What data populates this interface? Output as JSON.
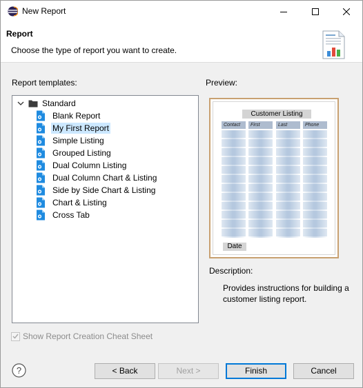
{
  "window": {
    "title": "New Report"
  },
  "banner": {
    "title": "Report",
    "description": "Choose the type of report you want to create."
  },
  "templates": {
    "label": "Report templates:",
    "root": "Standard",
    "items": [
      {
        "label": "Blank Report",
        "selected": false
      },
      {
        "label": "My First Report",
        "selected": true
      },
      {
        "label": "Simple Listing",
        "selected": false
      },
      {
        "label": "Grouped Listing",
        "selected": false
      },
      {
        "label": "Dual Column Listing",
        "selected": false
      },
      {
        "label": "Dual Column Chart & Listing",
        "selected": false
      },
      {
        "label": "Side by Side Chart & Listing",
        "selected": false
      },
      {
        "label": "Chart & Listing",
        "selected": false
      },
      {
        "label": "Cross Tab",
        "selected": false
      }
    ]
  },
  "preview": {
    "label": "Preview:",
    "report_title": "Customer Listing",
    "columns": [
      "Contact",
      "First",
      "Last",
      "Phone"
    ],
    "footer": "Date"
  },
  "description": {
    "label": "Description:",
    "text": "Provides instructions for building a customer listing report."
  },
  "cheat_sheet": {
    "label": "Show Report Creation Cheat Sheet",
    "checked": true,
    "enabled": false
  },
  "buttons": {
    "back": "< Back",
    "next": "Next >",
    "finish": "Finish",
    "cancel": "Cancel"
  },
  "colors": {
    "selection": "#cce8ff",
    "default_button_border": "#0078d7",
    "preview_frame": "#c8a070"
  }
}
